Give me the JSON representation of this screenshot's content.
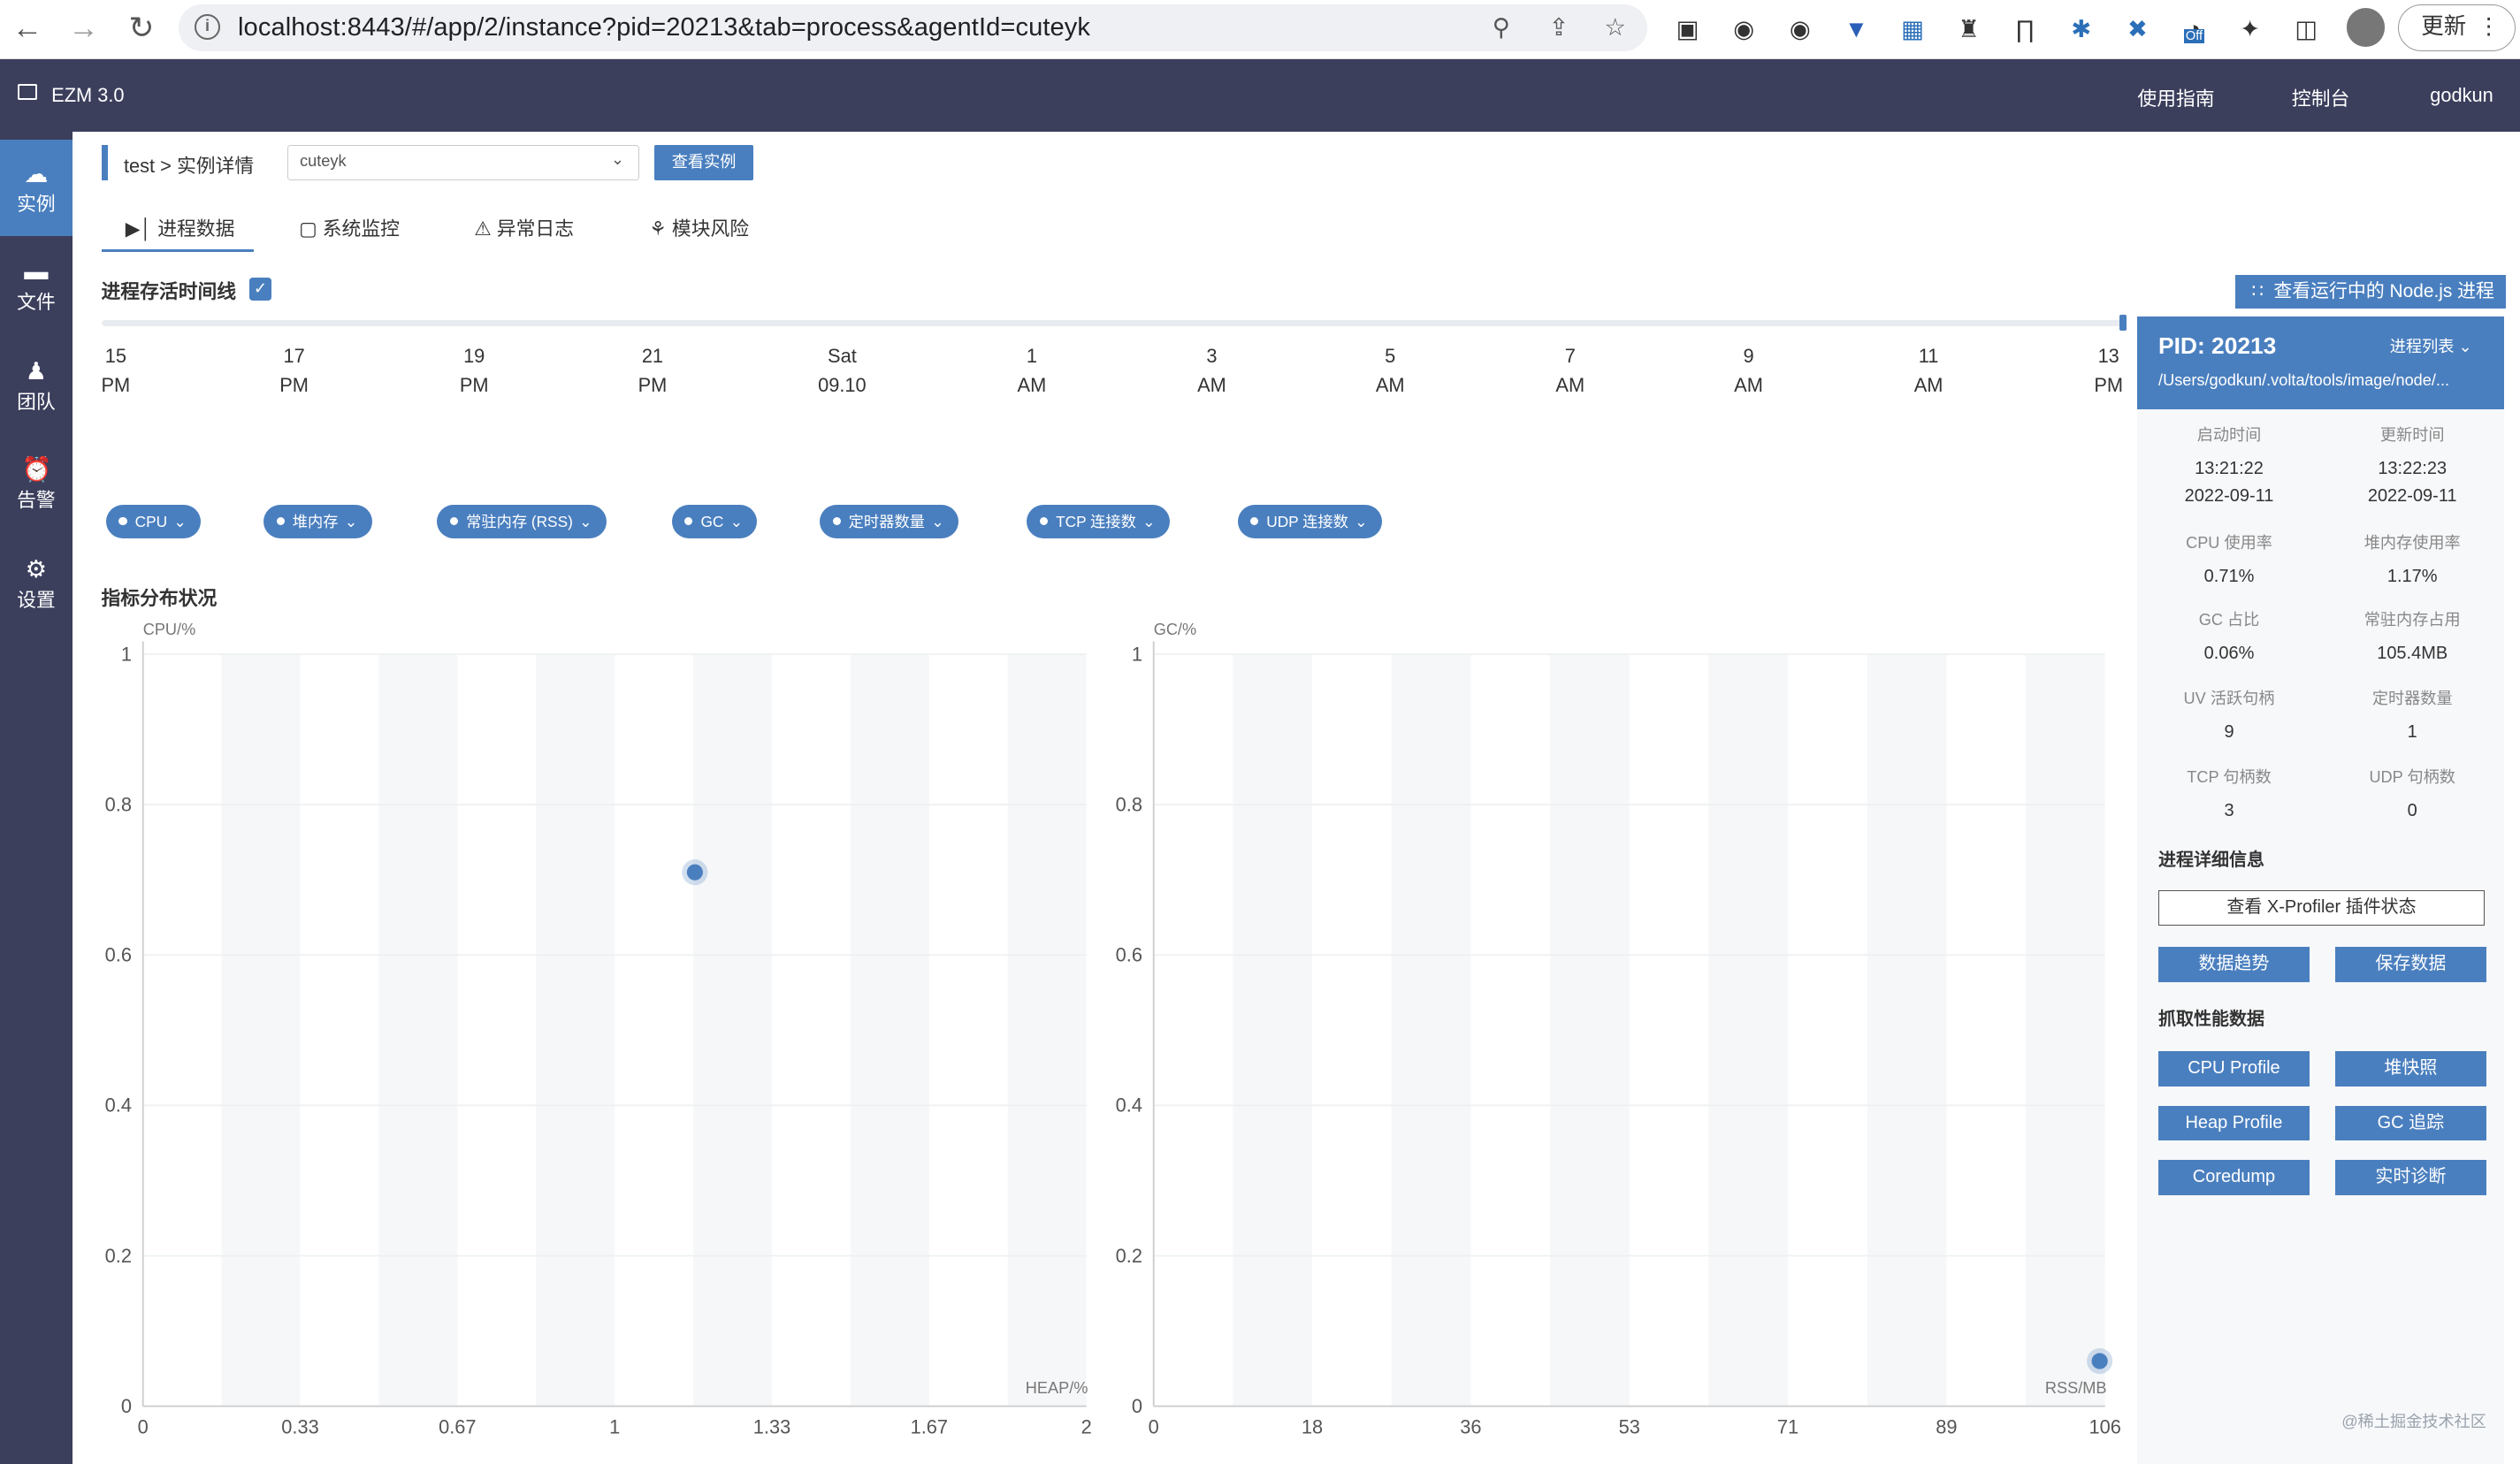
{
  "browser": {
    "url": "localhost:8443/#/app/2/instance?pid=20213&tab=process&agentId=cuteyk",
    "update_label": "更新",
    "ext_off_badge": "Off"
  },
  "app": {
    "title": "EZM 3.0",
    "nav": {
      "guide": "使用指南",
      "console": "控制台",
      "user": "godkun"
    }
  },
  "sidebar": {
    "items": [
      {
        "label": "实例",
        "icon": "cloud-icon"
      },
      {
        "label": "文件",
        "icon": "folder-icon"
      },
      {
        "label": "团队",
        "icon": "team-icon"
      },
      {
        "label": "告警",
        "icon": "alarm-icon"
      },
      {
        "label": "设置",
        "icon": "gear-icon"
      }
    ]
  },
  "breadcrumb": {
    "app": "test",
    "sep": ">",
    "page": "实例详情"
  },
  "instance_select": {
    "value": "cuteyk"
  },
  "view_instance_label": "查看实例",
  "tabs": [
    {
      "label": "进程数据",
      "active": true
    },
    {
      "label": "系统监控"
    },
    {
      "label": "异常日志"
    },
    {
      "label": "模块风险"
    }
  ],
  "timeline": {
    "title": "进程存活时间线",
    "checked": true,
    "ticks": [
      {
        "top": "15",
        "bottom": "PM"
      },
      {
        "top": "17",
        "bottom": "PM"
      },
      {
        "top": "19",
        "bottom": "PM"
      },
      {
        "top": "21",
        "bottom": "PM"
      },
      {
        "top": "Sat",
        "bottom": "09.10"
      },
      {
        "top": "1",
        "bottom": "AM"
      },
      {
        "top": "3",
        "bottom": "AM"
      },
      {
        "top": "5",
        "bottom": "AM"
      },
      {
        "top": "7",
        "bottom": "AM"
      },
      {
        "top": "9",
        "bottom": "AM"
      },
      {
        "top": "11",
        "bottom": "AM"
      },
      {
        "top": "13",
        "bottom": "PM"
      }
    ]
  },
  "node_process_button": "查看运行中的 Node.js 进程",
  "metric_pills": [
    "CPU",
    "堆内存",
    "常驻内存 (RSS)",
    "GC",
    "定时器数量",
    "TCP 连接数",
    "UDP 连接数"
  ],
  "distribution_title": "指标分布状况",
  "chart_data": [
    {
      "type": "scatter",
      "ylabel": "CPU/%",
      "xlabel": "HEAP/%",
      "x_ticks": [
        "0",
        "0.33",
        "0.67",
        "1",
        "1.33",
        "1.67",
        "2"
      ],
      "y_ticks": [
        "0",
        "0.2",
        "0.4",
        "0.6",
        "0.8",
        "1"
      ],
      "xlim": [
        0,
        2
      ],
      "ylim": [
        0,
        1
      ],
      "points": [
        {
          "x": 1.17,
          "y": 0.71
        }
      ]
    },
    {
      "type": "scatter",
      "ylabel": "GC/%",
      "xlabel": "RSS/MB",
      "x_ticks": [
        "0",
        "18",
        "36",
        "53",
        "71",
        "89",
        "106"
      ],
      "y_ticks": [
        "0",
        "0.2",
        "0.4",
        "0.6",
        "0.8",
        "1"
      ],
      "xlim": [
        0,
        106
      ],
      "ylim": [
        0,
        1
      ],
      "points": [
        {
          "x": 105.4,
          "y": 0.06
        }
      ]
    }
  ],
  "panel": {
    "pid": "PID: 20213",
    "process_list_label": "进程列表",
    "path": "/Users/godkun/.volta/tools/image/node/...",
    "stats": [
      {
        "label": "启动时间",
        "value": "13:21:22",
        "value2": "2022-09-11"
      },
      {
        "label": "更新时间",
        "value": "13:22:23",
        "value2": "2022-09-11"
      },
      {
        "label": "CPU 使用率",
        "value": "0.71%"
      },
      {
        "label": "堆内存使用率",
        "value": "1.17%"
      },
      {
        "label": "GC 占比",
        "value": "0.06%"
      },
      {
        "label": "常驻内存占用",
        "value": "105.4MB"
      },
      {
        "label": "UV 活跃句柄",
        "value": "9"
      },
      {
        "label": "定时器数量",
        "value": "1"
      },
      {
        "label": "TCP 句柄数",
        "value": "3"
      },
      {
        "label": "UDP 句柄数",
        "value": "0"
      }
    ],
    "detail_title": "进程详细信息",
    "xprofiler_button": "查看 X-Profiler 插件状态",
    "trend_button": "数据趋势",
    "save_button": "保存数据",
    "perf_title": "抓取性能数据",
    "perf_buttons": [
      "CPU Profile",
      "堆快照",
      "Heap Profile",
      "GC 追踪",
      "Coredump",
      "实时诊断"
    ]
  },
  "watermark": "@稀土掘金技术社区",
  "colors": {
    "accent": "#4a7fbf",
    "sidebar": "#3b3f5c"
  }
}
